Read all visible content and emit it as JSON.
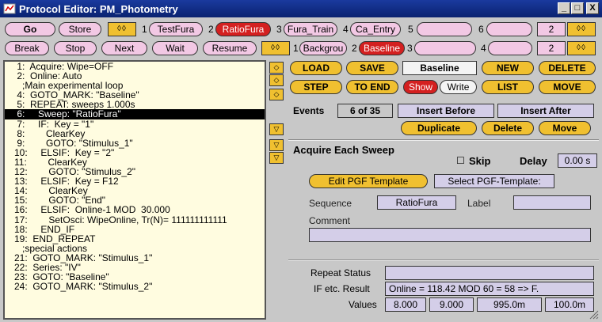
{
  "window": {
    "title": "Protocol Editor:  PM_Photometry",
    "controls": [
      "_",
      "□",
      "X"
    ]
  },
  "toolbar1": {
    "go": "Go",
    "store": "Store",
    "arrows": "◊◊",
    "slots": [
      {
        "num": "1",
        "label": "TestFura"
      },
      {
        "num": "2",
        "label": "RatioFura"
      },
      {
        "num": "3",
        "label": "Fura_Train"
      },
      {
        "num": "4",
        "label": "Ca_Entry"
      },
      {
        "num": "5",
        "label": ""
      },
      {
        "num": "6",
        "label": ""
      }
    ],
    "counter": "2"
  },
  "toolbar2": {
    "break": "Break",
    "stop": "Stop",
    "next": "Next",
    "wait": "Wait",
    "resume": "Resume",
    "arrows": "◊◊",
    "slots": [
      {
        "num": "1",
        "label": "Backgrou"
      },
      {
        "num": "2",
        "label": "Baseline"
      },
      {
        "num": "3",
        "label": ""
      },
      {
        "num": "4",
        "label": ""
      }
    ],
    "counter": "2"
  },
  "list": [
    " 1:  Acquire: Wipe=OFF",
    " 2:  Online: Auto",
    "   ;Main experimental loop",
    " 4:  GOTO_MARK: \"Baseline\"",
    " 5:  REPEAT: sweeps 1.000s",
    " 6:     Sweep: \"RatioFura\"",
    " 7:     IF:  Key = \"1\"",
    " 8:        ClearKey",
    " 9:        GOTO: \"Stimulus_1\"",
    "10:     ELSIF:  Key = \"2\"",
    "11:        ClearKey",
    "12:        GOTO: \"Stimulus_2\"",
    "13:     ELSIF:  Key = F12",
    "14:        ClearKey",
    "15:        GOTO: \"End\"",
    "16:     ELSIF:  Online-1 MOD  30.000",
    "17:        SetOsci: WipeOnline, Tr(N)= 111111111111",
    "18:     END_IF",
    "19:  END_REPEAT",
    "   ;special actions",
    "21:  GOTO_MARK: \"Stimulus_1\"",
    "22:  Series: \"IV\"",
    "23:  GOTO: \"Baseline\"",
    "24:  GOTO_MARK: \"Stimulus_2\""
  ],
  "selected_index": 5,
  "scroll_arrows": {
    "up": "◇",
    "down": "▽"
  },
  "edit": {
    "load": "LOAD",
    "save": "SAVE",
    "seqname": "Baseline",
    "new": "NEW",
    "delete": "DELETE",
    "step": "STEP",
    "to_end": "TO END",
    "show": "Show",
    "write": "Write",
    "list": "LIST",
    "move": "MOVE"
  },
  "events": {
    "label": "Events",
    "count": "6 of 35",
    "insert_before": "Insert Before",
    "insert_after": "Insert After",
    "duplicate": "Duplicate",
    "delete": "Delete",
    "move": "Move"
  },
  "sweep": {
    "header": "Acquire Each Sweep",
    "skip_label": "Skip",
    "delay_label": "Delay",
    "delay_value": "0.00 s",
    "edit_pgf": "Edit PGF Template",
    "select_pgf": "Select PGF-Template:",
    "sequence_label": "Sequence",
    "sequence_value": "RatioFura",
    "label_label": "Label",
    "label_value": "",
    "comment_label": "Comment",
    "comment_value": ""
  },
  "status": {
    "repeat_label": "Repeat Status",
    "repeat_value": "",
    "if_label": "IF etc. Result",
    "if_value": "Online =  118.42  MOD 60 = 58 => F.",
    "values_label": "Values",
    "values": [
      "8.000",
      "9.000",
      "995.0m",
      "100.0m"
    ]
  },
  "colors": {
    "pink": "#f2c8e4",
    "red": "#d42020",
    "yellow": "#f0c030",
    "lavender": "#d4cee8",
    "list_bg": "#fffce0",
    "title_blue": "#0a2270"
  }
}
